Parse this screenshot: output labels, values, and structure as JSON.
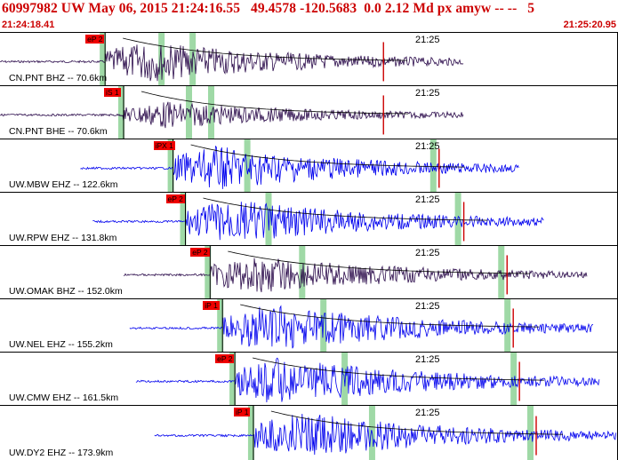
{
  "header": {
    "title": "60997982 UW May 06, 2015 21:24:16.55   49.4578 -120.5683  0.0 2.12 Md px amyw -- --   5",
    "start_time": "21:24:18.41",
    "end_time": "21:25:20.95"
  },
  "colors": {
    "header_text": "#cc0000",
    "pick_box": "#ee0000",
    "wave_blue": "#0000ee",
    "wave_purple": "#2a0a4a",
    "green_band": "#9fd9a6",
    "pick_line": "#cc0000"
  },
  "traces": [
    {
      "label": "CN.PNT BHZ -- 70.6km",
      "time": "21:25",
      "pick": "eP 2",
      "color": "purple",
      "onset": 0.17,
      "end": 0.75,
      "amp": 22
    },
    {
      "label": "CN.PNT BHE -- 70.6km",
      "time": "21:25",
      "pick": "iS 1",
      "color": "purple",
      "onset": 0.2,
      "end": 0.75,
      "amp": 14
    },
    {
      "label": "UW.MBW EHZ -- 122.6km",
      "time": "21:25",
      "pick": "iPX 1",
      "color": "blue",
      "onset": 0.28,
      "end": 0.84,
      "amp": 24
    },
    {
      "label": "UW.RPW EHZ -- 131.8km",
      "time": "21:25",
      "pick": "eP 2",
      "color": "blue",
      "onset": 0.3,
      "end": 0.88,
      "amp": 24
    },
    {
      "label": "UW.OMAK BHZ -- 152.0km",
      "time": "21:25",
      "pick": "eP 2",
      "color": "purple",
      "onset": 0.34,
      "end": 0.95,
      "amp": 20
    },
    {
      "label": "UW.NEL EHZ -- 155.2km",
      "time": "21:25",
      "pick": "iP 1",
      "color": "blue",
      "onset": 0.36,
      "end": 0.96,
      "amp": 26
    },
    {
      "label": "UW.CMW EHZ -- 161.5km",
      "time": "21:25",
      "pick": "eP 2",
      "color": "blue",
      "onset": 0.38,
      "end": 0.97,
      "amp": 26
    },
    {
      "label": "UW.DY2 EHZ -- 173.9km",
      "time": "21:25",
      "pick": "iP 1",
      "color": "blue",
      "onset": 0.41,
      "end": 1.0,
      "amp": 26
    }
  ]
}
